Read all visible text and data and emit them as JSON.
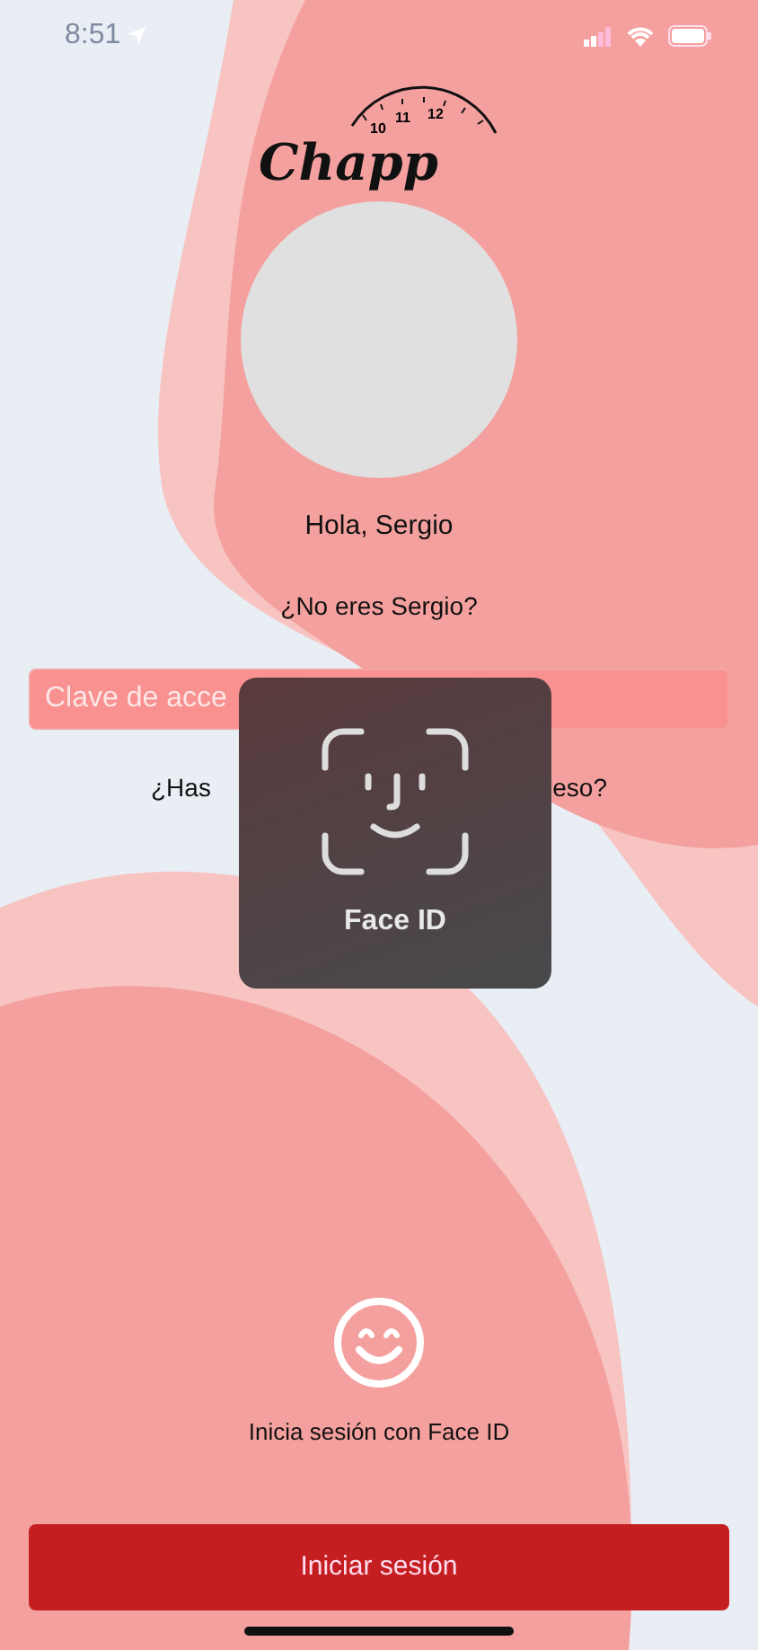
{
  "status_bar": {
    "time": "8:51"
  },
  "logo": {
    "wordmark": "Chapp",
    "dial_numbers": [
      "10",
      "11",
      "12"
    ]
  },
  "greeting": "Hola, Sergio",
  "not_you_link": "¿No eres Sergio?",
  "password_field": {
    "placeholder": "Clave de acce"
  },
  "forgot_link": {
    "left_part": "¿Has",
    "right_part": "eso?"
  },
  "face_id_overlay": {
    "label": "Face ID"
  },
  "face_id_prompt": "Inicia sesión con Face ID",
  "login_button": "Iniciar sesión"
}
